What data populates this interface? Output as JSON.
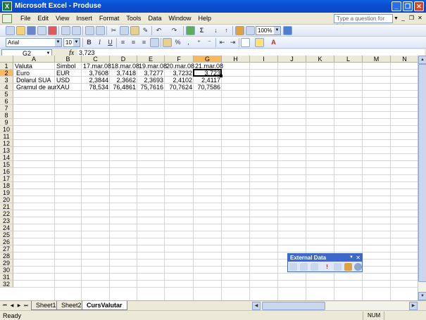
{
  "window": {
    "title": "Microsoft Excel - Produse",
    "app_icon": "X"
  },
  "menu": {
    "items": [
      "File",
      "Edit",
      "View",
      "Insert",
      "Format",
      "Tools",
      "Data",
      "Window",
      "Help"
    ],
    "help_placeholder": "Type a question for help"
  },
  "toolbar": {
    "zoom": "100%",
    "font_name": "Arial",
    "font_size": "10",
    "bold": "B",
    "italic": "I",
    "underline": "U",
    "autosum": "Σ",
    "percent": "%",
    "font_color_label": "A"
  },
  "formula_bar": {
    "name_box": "G2",
    "fx": "fx",
    "value": "3,723"
  },
  "grid": {
    "columns": [
      "A",
      "B",
      "C",
      "D",
      "E",
      "F",
      "G",
      "H",
      "I",
      "J",
      "K",
      "L",
      "M",
      "N"
    ],
    "row_count": 32,
    "selected_column": "G",
    "selected_row": 2,
    "rows": [
      {
        "row": 1,
        "cells": [
          "Valuta",
          "Simbol",
          "17.mar.08",
          "18.mar.08",
          "19.mar.08",
          "20.mar.08",
          "21.mar.08"
        ]
      },
      {
        "row": 2,
        "cells": [
          "Euro",
          "EUR",
          "3,7608",
          "3,7418",
          "3,7277",
          "3,7232",
          "3,723"
        ]
      },
      {
        "row": 3,
        "cells": [
          "Dolarul SUA",
          "USD",
          "2,3844",
          "2,3662",
          "2,3693",
          "2,4102",
          "2,4117"
        ]
      },
      {
        "row": 4,
        "cells": [
          "Gramul de aur",
          "XAU",
          "78,534",
          "76,4861",
          "75,7616",
          "70,7624",
          "70,7586"
        ]
      }
    ]
  },
  "sheets": {
    "tabs": [
      "Sheet1",
      "Sheet2",
      "CursValutar"
    ],
    "active": "CursValutar"
  },
  "status": {
    "left": "Ready",
    "num": "NUM"
  },
  "external_data_toolbar": {
    "title": "External Data"
  }
}
